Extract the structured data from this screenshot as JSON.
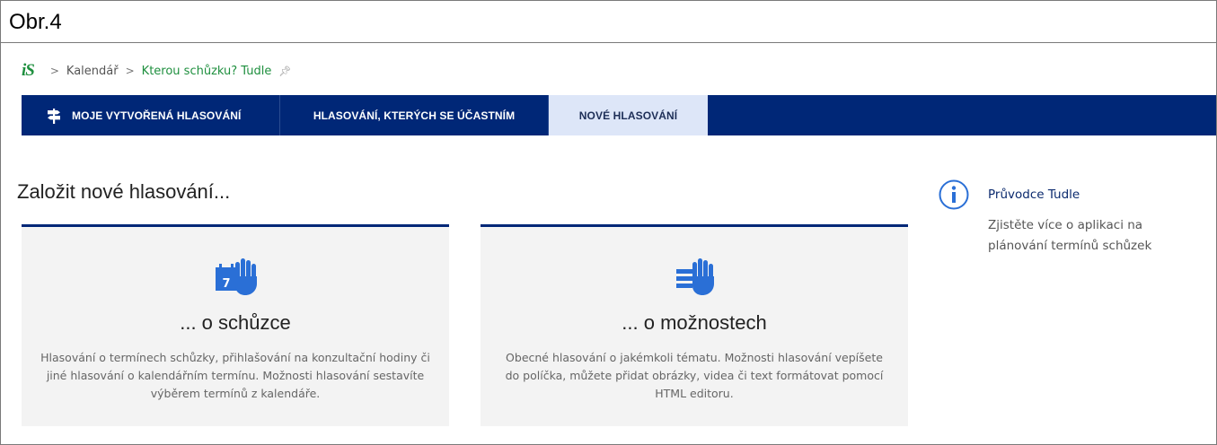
{
  "figure_caption": "Obr.4",
  "breadcrumb": {
    "logo": "iS",
    "items": [
      "Kalendář",
      "Kterou schůzku? Tudle"
    ]
  },
  "nav": {
    "tabs": [
      {
        "label": "MOJE VYTVOŘENÁ HLASOVÁNÍ",
        "icon": "signpost-icon"
      },
      {
        "label": "HLASOVÁNÍ, KTERÝCH SE ÚČASTNÍM"
      },
      {
        "label": "NOVÉ HLASOVÁNÍ",
        "active": true
      }
    ]
  },
  "main": {
    "title": "Založit nové hlasování...",
    "cards": [
      {
        "icon": "calendar-hand-icon",
        "calendar_day": "7",
        "title": "... o schůzce",
        "description": "Hlasování o termínech schůzky, přihlašování na konzultační hodiny či jiné hlasování o kalendářním termínu. Možnosti hlasování sestavíte výběrem termínů z kalendáře."
      },
      {
        "icon": "list-hand-icon",
        "title": "... o možnostech",
        "description": "Obecné hlasování o jakémkoli tématu. Možnosti hlasování vepíšete do políčka, můžete přidat obrázky, videa či text formátovat pomocí HTML editoru."
      }
    ]
  },
  "sidebar": {
    "icon": "info-icon",
    "title": "Průvodce Tudle",
    "text": "Zjistěte více o aplikaci na plánování termínů schůzek"
  },
  "colors": {
    "nav_bg": "#002777",
    "active_tab_bg": "#dde6f8",
    "accent_blue": "#2a6fd6",
    "brand_green": "#1e8f3e"
  }
}
